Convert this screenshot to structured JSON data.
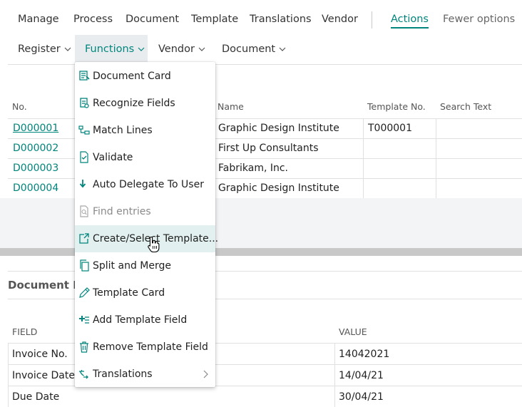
{
  "actionbar": {
    "tabs": [
      "Manage",
      "Process",
      "Document",
      "Template",
      "Translations",
      "Vendor"
    ],
    "actions_label": "Actions",
    "fewer_label": "Fewer options"
  },
  "subbar": {
    "items": [
      "Register",
      "Functions",
      "Vendor",
      "Document"
    ],
    "selected": "Functions"
  },
  "list": {
    "headers": {
      "no": "No.",
      "name": "Name",
      "template_no": "Template No.",
      "search_text": "Search Text"
    },
    "rows": [
      {
        "no": "D000001",
        "name": "Graphic Design Institute",
        "template_no": "T000001"
      },
      {
        "no": "D000002",
        "name": "First Up Consultants",
        "template_no": ""
      },
      {
        "no": "D000003",
        "name": "Fabrikam, Inc.",
        "template_no": ""
      },
      {
        "no": "D000004",
        "name": "Graphic Design Institute",
        "template_no": ""
      }
    ]
  },
  "document_header": {
    "title_visible": "Document He",
    "headers": {
      "field": "FIELD",
      "value": "VALUE"
    },
    "rows": [
      {
        "field": "Invoice No.",
        "value": "14042021"
      },
      {
        "field": "Invoice Date",
        "value": "14/04/21"
      },
      {
        "field": "Due Date",
        "value": "30/04/21"
      }
    ]
  },
  "functions_menu": {
    "items": [
      {
        "label": "Document Card",
        "icon": "document-card-icon"
      },
      {
        "label": "Recognize Fields",
        "icon": "recognize-fields-icon"
      },
      {
        "label": "Match Lines",
        "icon": "match-lines-icon"
      },
      {
        "label": "Validate",
        "icon": "validate-icon"
      },
      {
        "label": "Auto Delegate To User",
        "icon": "arrow-down-icon"
      },
      {
        "label": "Find entries",
        "icon": "find-entries-icon",
        "disabled": true
      },
      {
        "label": "Create/Select Template...",
        "icon": "create-template-icon",
        "highlighted": true
      },
      {
        "label": "Split and Merge",
        "icon": "copy-icon"
      },
      {
        "label": "Template Card",
        "icon": "pencil-icon"
      },
      {
        "label": "Add Template Field",
        "icon": "add-field-icon"
      },
      {
        "label": "Remove Template Field",
        "icon": "trash-icon"
      },
      {
        "label": "Translations",
        "icon": "translate-icon",
        "submenu": true
      }
    ]
  },
  "colors": {
    "accent": "#00857c",
    "highlight": "#e2f0ef",
    "selected_bg": "#e9ecef"
  }
}
